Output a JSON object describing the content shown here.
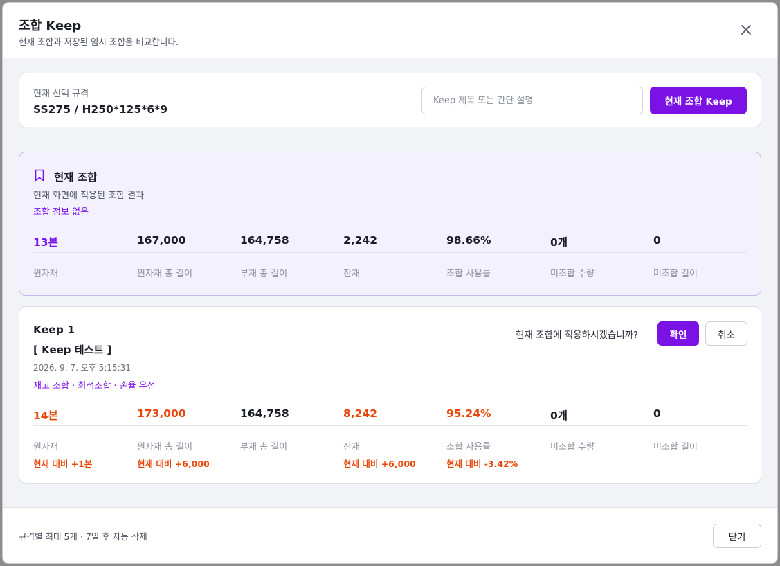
{
  "dialog": {
    "title": "조합 Keep",
    "subtitle": "현재 조합과 저장된 임시 조합을 비교합니다."
  },
  "spec": {
    "label": "현재 선택 규격",
    "value": "SS275 / H250*125*6*9",
    "input_placeholder": "Keep 제목 또는 간단 설명",
    "keep_button": "현재 조합 Keep"
  },
  "current": {
    "title": "현재 조합",
    "desc": "현재 화면에 적용된 조합 결과",
    "info": "조합 정보 없음",
    "stats": [
      {
        "value": "13본",
        "label": "원자재"
      },
      {
        "value": "167,000",
        "label": "원자재 총 길이"
      },
      {
        "value": "164,758",
        "label": "부재 총 길이"
      },
      {
        "value": "2,242",
        "label": "잔재"
      },
      {
        "value": "98.66%",
        "label": "조합 사용률"
      },
      {
        "value": "0개",
        "label": "미조합 수량"
      },
      {
        "value": "0",
        "label": "미조합 길이"
      }
    ]
  },
  "keep": {
    "title": "Keep 1",
    "name": "[ Keep 테스트 ]",
    "date": "2026. 9. 7. 오후 5:15:31",
    "tags": "재고 조합 · 최적조합 · 손율 우선",
    "apply_question": "현재 조합에 적용하시겠습니까?",
    "confirm_button": "확인",
    "cancel_button": "취소",
    "stats": [
      {
        "value": "14본",
        "label": "원자재",
        "delta": "현재 대비 +1본"
      },
      {
        "value": "173,000",
        "label": "원자재 총 길이",
        "delta": "현재 대비 +6,000"
      },
      {
        "value": "164,758",
        "label": "부재 총 길이",
        "delta": ""
      },
      {
        "value": "8,242",
        "label": "잔재",
        "delta": "현재 대비 +6,000"
      },
      {
        "value": "95.24%",
        "label": "조합 사용률",
        "delta": "현재 대비 -3.42%"
      },
      {
        "value": "0개",
        "label": "미조합 수량",
        "delta": ""
      },
      {
        "value": "0",
        "label": "미조합 길이",
        "delta": ""
      }
    ]
  },
  "footer": {
    "note": "규격별 최대 5개 · 7일 후 자동 삭제",
    "close_button": "닫기"
  },
  "colors": {
    "accent": "#7a12e6",
    "warning": "#e8470b",
    "current_bg": "#f3f1fd"
  }
}
